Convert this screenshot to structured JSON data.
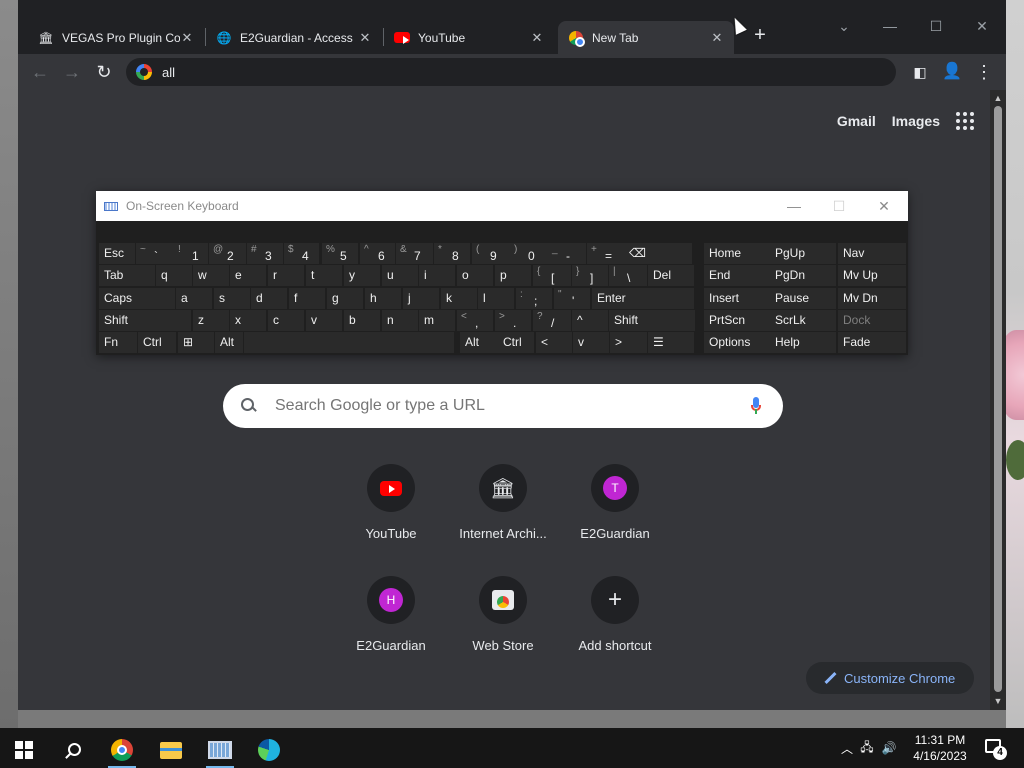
{
  "tabs": [
    {
      "title": "VEGAS Pro Plugin Co",
      "icon": "archive-icon",
      "active": false
    },
    {
      "title": "E2Guardian - Access",
      "icon": "globe-icon",
      "active": false
    },
    {
      "title": "YouTube",
      "icon": "youtube-icon",
      "active": false
    },
    {
      "title": "New Tab",
      "icon": "chrome-icon",
      "active": true
    }
  ],
  "omnibox": {
    "value": "all"
  },
  "toplinks": {
    "gmail": "Gmail",
    "images": "Images"
  },
  "search": {
    "placeholder": "Search Google or type a URL"
  },
  "shortcuts": [
    {
      "label": "YouTube",
      "icon": "youtube-icon"
    },
    {
      "label": "Internet Archi...",
      "icon": "internet-archive-icon"
    },
    {
      "label": "E2Guardian",
      "icon": "letter-t-icon",
      "letter": "T"
    },
    {
      "label": "E2Guardian",
      "icon": "letter-h-icon",
      "letter": "H"
    },
    {
      "label": "Web Store",
      "icon": "web-store-icon"
    },
    {
      "label": "Add shortcut",
      "icon": "plus-icon"
    }
  ],
  "customize": {
    "label": "Customize Chrome"
  },
  "osk": {
    "title": "On-Screen Keyboard",
    "rows": [
      [
        "Esc",
        "~ `",
        "! 1",
        "@ 2",
        "# 3",
        "$ 4",
        "% 5",
        "^ 6",
        "& 7",
        "* 8",
        "( 9",
        ") 0",
        "_ -",
        "+ =",
        "⌫",
        "Home",
        "PgUp",
        "Nav"
      ],
      [
        "Tab",
        "q",
        "w",
        "e",
        "r",
        "t",
        "y",
        "u",
        "i",
        "o",
        "p",
        "{ [",
        "} ]",
        "| \\",
        "Del",
        "End",
        "PgDn",
        "Mv Up"
      ],
      [
        "Caps",
        "a",
        "s",
        "d",
        "f",
        "g",
        "h",
        "j",
        "k",
        "l",
        ": ;",
        "\" '",
        "Enter",
        "Insert",
        "Pause",
        "Mv Dn"
      ],
      [
        "Shift",
        "z",
        "x",
        "c",
        "v",
        "b",
        "n",
        "m",
        "< ,",
        "> .",
        "? /",
        "^",
        "Shift",
        "PrtScn",
        "ScrLk",
        "Dock"
      ],
      [
        "Fn",
        "Ctrl",
        "⊞",
        "Alt",
        "",
        "Alt",
        "Ctrl",
        "<",
        "v",
        ">",
        "☰",
        "Options",
        "Help",
        "Fade"
      ]
    ]
  },
  "taskbar": {
    "time": "11:31 PM",
    "date": "4/16/2023",
    "notifications": "4"
  },
  "colors": {
    "accent": "#8ab4f8",
    "page_bg": "#35363a",
    "chrome_frame": "#202124"
  }
}
